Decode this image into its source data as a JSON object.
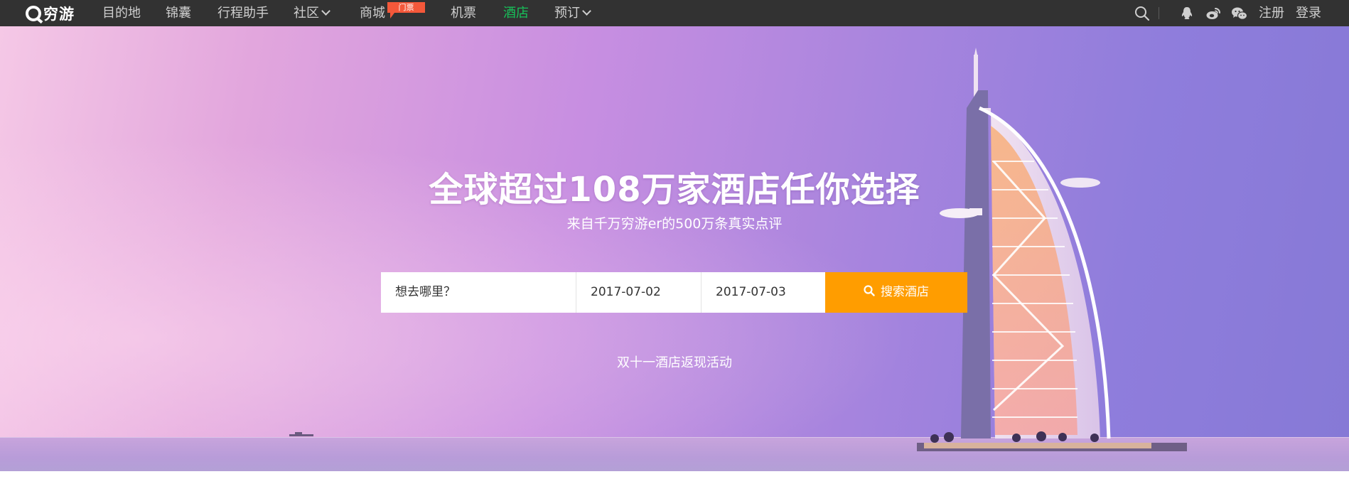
{
  "nav": {
    "logo_text": "穷游",
    "items": [
      {
        "label": "目的地"
      },
      {
        "label": "锦囊"
      },
      {
        "label": "行程助手"
      },
      {
        "label": "社区"
      },
      {
        "label": "商城",
        "badge": "门票"
      },
      {
        "label": "机票"
      },
      {
        "label": "酒店"
      },
      {
        "label": "预订"
      }
    ],
    "active_item": "酒店",
    "register_label": "注册",
    "login_label": "登录",
    "icons": [
      "search-icon",
      "qq-icon",
      "weibo-icon",
      "wechat-icon"
    ]
  },
  "hero": {
    "title": "全球超过108万家酒店任你选择",
    "subtitle": "来自千万穷游er的500万条真实点评"
  },
  "search": {
    "destination_placeholder": "想去哪里？",
    "checkin_value": "2017-07-02",
    "checkout_value": "2017-07-03",
    "button_label": "搜索酒店"
  },
  "promo_link": "双十一酒店返现活动",
  "colors": {
    "nav_background": "#323232",
    "active_nav": "#17c35a",
    "badge": "#f4583a",
    "search_button": "#ff9d00"
  }
}
